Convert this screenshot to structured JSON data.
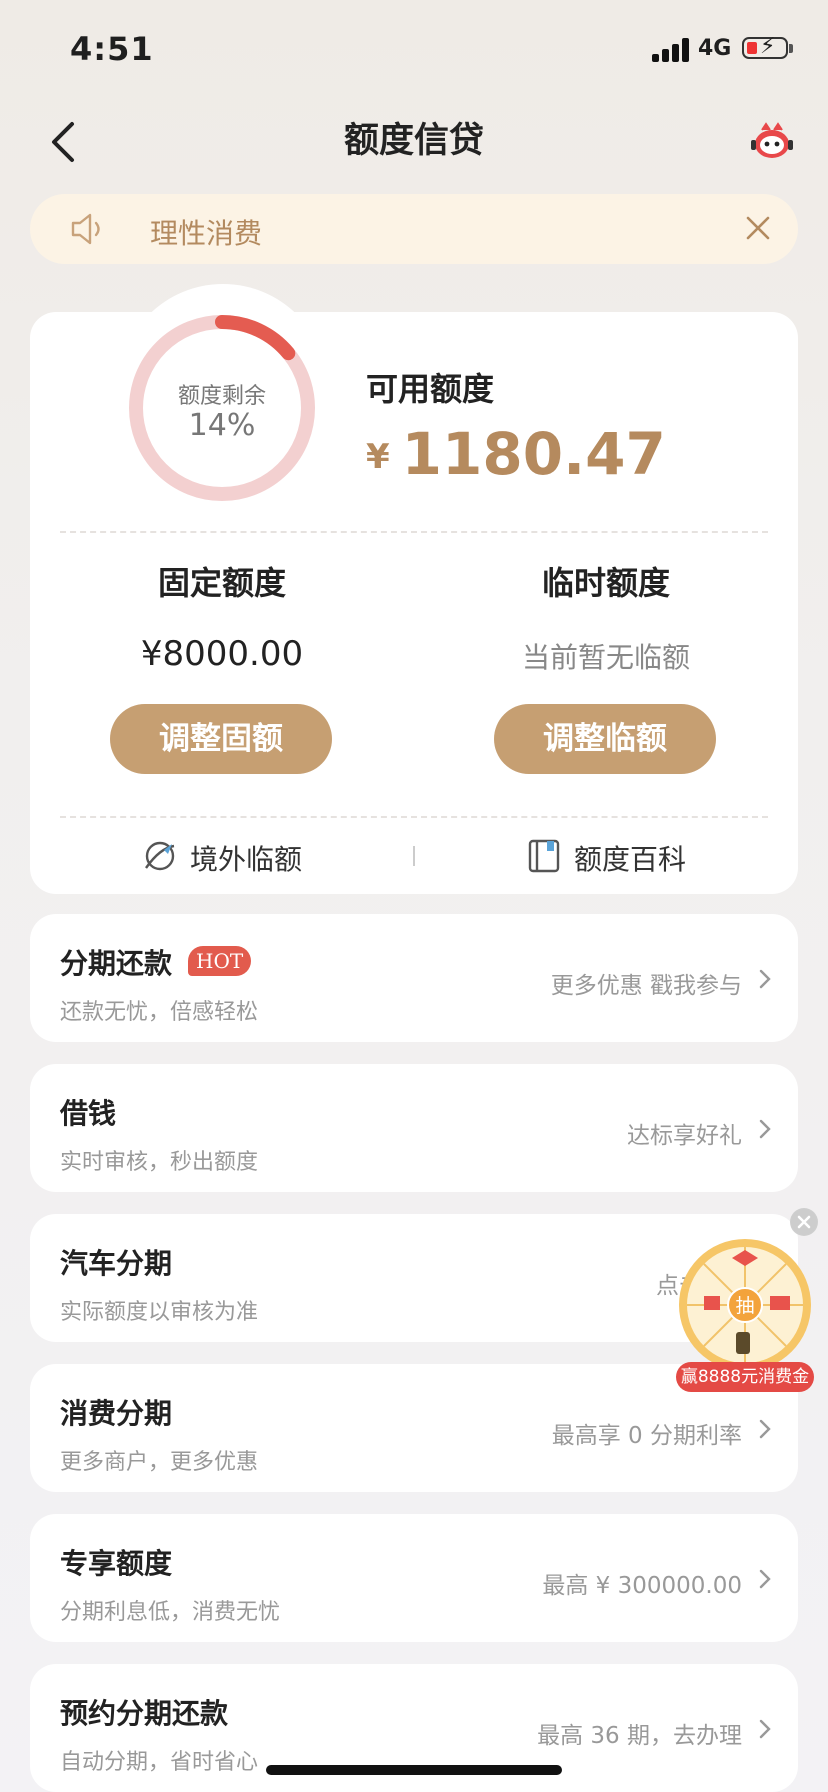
{
  "status_bar": {
    "time": "4:51",
    "network": "4G",
    "battery_color": "#e53935"
  },
  "header": {
    "title": "额度信贷",
    "back_icon": "chevron-left-icon",
    "service_icon": "robot-assistant-icon"
  },
  "notice": {
    "text": "理性消费",
    "icon": "speaker-icon"
  },
  "credit": {
    "ring_label": "额度剩余",
    "ring_percent": "14%",
    "ring_fraction": 0.14,
    "available_label": "可用额度",
    "currency": "¥",
    "available_amount": "1180.47",
    "fixed_title": "固定额度",
    "fixed_amount": "¥8000.00",
    "fixed_button": "调整固额",
    "temp_title": "临时额度",
    "temp_note": "当前暂无临额",
    "temp_button": "调整临额",
    "overseas_label": "境外临额",
    "wiki_label": "额度百科",
    "accent_color": "#c69f72"
  },
  "rows": [
    {
      "title": "分期还款",
      "badge": "HOT",
      "sub": "还款无忧，倍感轻松",
      "right": "更多优惠 戳我参与"
    },
    {
      "title": "借钱",
      "sub": "实时审核，秒出额度",
      "right": "达标享好礼"
    },
    {
      "title": "汽车分期",
      "sub": "实际额度以审核为准",
      "right": "点击"
    },
    {
      "title": "消费分期",
      "sub": "更多商户，更多优惠",
      "right": "最高享 0 分期利率"
    },
    {
      "title": "专享额度",
      "sub": "分期利息低，消费无忧",
      "right": "最高 ¥ 300000.00"
    },
    {
      "title": "预约分期还款",
      "sub": "自动分期，省时省心",
      "right": "最高 36 期，去办理"
    }
  ],
  "float_widget": {
    "center": "抽",
    "badge": "赢8888元消费金"
  }
}
